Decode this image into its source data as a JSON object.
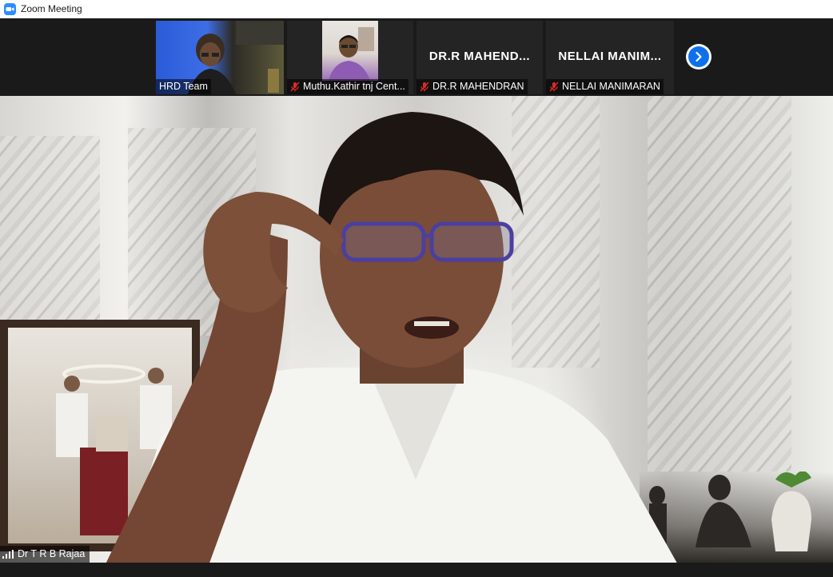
{
  "window": {
    "title": "Zoom Meeting",
    "app_icon": "zoom-camera-icon"
  },
  "thumbnails": [
    {
      "name": "HRD Team",
      "muted": false,
      "has_video": true
    },
    {
      "name": "Muthu.Kathir tnj Cent...",
      "muted": true,
      "has_video": true
    },
    {
      "name": "DR.R MAHENDRAN",
      "display_name": "DR.R  MAHEND...",
      "muted": true,
      "has_video": false
    },
    {
      "name": "NELLAI MANIMARAN",
      "display_name": "NELLAI  MANIM...",
      "muted": true,
      "has_video": false
    }
  ],
  "strip_nav": {
    "icon": "chevron-right-icon"
  },
  "active_speaker": {
    "name": "Dr T R B Rajaa",
    "icon": "signal-strength-icon"
  },
  "colors": {
    "zoom_blue": "#0e71eb",
    "mute_red": "#e02828",
    "strip_bg": "#1a1a1a"
  }
}
